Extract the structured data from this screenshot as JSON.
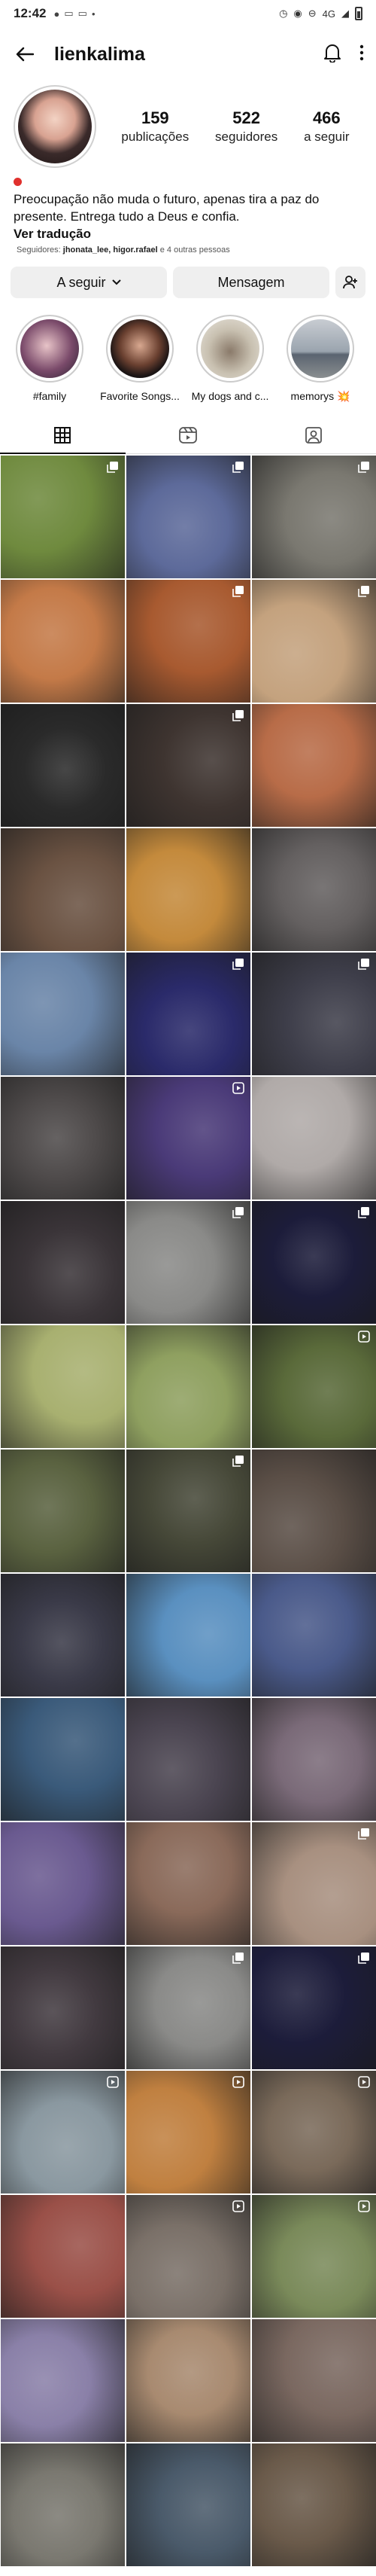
{
  "status": {
    "time": "12:42",
    "network": "4G"
  },
  "header": {
    "username": "lienkalima"
  },
  "profile": {
    "stats": [
      {
        "num": "159",
        "label": "publicações"
      },
      {
        "num": "522",
        "label": "seguidores"
      },
      {
        "num": "466",
        "label": "a seguir"
      }
    ],
    "bio_line1": "Preocupação não muda o futuro, apenas tira a paz do",
    "bio_line2": "presente. Entrega tudo a Deus e confia.",
    "translate": "Ver tradução",
    "followers_prefix": "Seguidores: ",
    "followers_names": "jhonata_lee, higor.rafael",
    "followers_suffix": " e 4 outras pessoas"
  },
  "actions": {
    "following": "A seguir",
    "message": "Mensagem"
  },
  "highlights": [
    {
      "label": "#family"
    },
    {
      "label": "Favorite Songs..."
    },
    {
      "label": "My dogs and c..."
    },
    {
      "label": "memorys 💥"
    }
  ],
  "grid": [
    {
      "c": "#6f8a3e",
      "badge": "multi"
    },
    {
      "c": "#5d6a9a",
      "badge": "multi"
    },
    {
      "c": "#7a7870",
      "badge": "multi"
    },
    {
      "c": "#c47a48",
      "badge": ""
    },
    {
      "c": "#a85a30",
      "badge": "multi"
    },
    {
      "c": "#c4a27e",
      "badge": "multi"
    },
    {
      "c": "#2a2a2a",
      "badge": ""
    },
    {
      "c": "#3e3430",
      "badge": "multi"
    },
    {
      "c": "#b86c48",
      "badge": ""
    },
    {
      "c": "#6a5242",
      "badge": ""
    },
    {
      "c": "#c48a3c",
      "badge": ""
    },
    {
      "c": "#646060",
      "badge": ""
    },
    {
      "c": "#6a85a8",
      "badge": ""
    },
    {
      "c": "#2a2a6a",
      "badge": "multi"
    },
    {
      "c": "#3e3e4a",
      "badge": "multi"
    },
    {
      "c": "#4e4a4a",
      "badge": ""
    },
    {
      "c": "#4a3a78",
      "badge": "reel"
    },
    {
      "c": "#b0aaa8",
      "badge": ""
    },
    {
      "c": "#3a3438",
      "badge": ""
    },
    {
      "c": "#8a8a88",
      "badge": "multi"
    },
    {
      "c": "#1c1c3a",
      "badge": "multi"
    },
    {
      "c": "#a8b070",
      "badge": ""
    },
    {
      "c": "#8fa060",
      "badge": ""
    },
    {
      "c": "#5a6a3a",
      "badge": "reel"
    },
    {
      "c": "#5a6240",
      "badge": ""
    },
    {
      "c": "#464838",
      "badge": "multi"
    },
    {
      "c": "#5a4e46",
      "badge": ""
    },
    {
      "c": "#3a3a48",
      "badge": ""
    },
    {
      "c": "#5a90c0",
      "badge": ""
    },
    {
      "c": "#4a5a8a",
      "badge": ""
    },
    {
      "c": "#3a5a7a",
      "badge": ""
    },
    {
      "c": "#4a4450",
      "badge": ""
    },
    {
      "c": "#7a6a78",
      "badge": ""
    },
    {
      "c": "#6a5a90",
      "badge": ""
    },
    {
      "c": "#8a6a5a",
      "badge": ""
    },
    {
      "c": "#a89080",
      "badge": "multi"
    },
    {
      "c": "#423a40",
      "badge": ""
    },
    {
      "c": "#8a8a88",
      "badge": "multi"
    },
    {
      "c": "#1c1c3a",
      "badge": "multi"
    },
    {
      "c": "#8a98a0",
      "badge": "reel"
    },
    {
      "c": "#c08040",
      "badge": "reel"
    },
    {
      "c": "#7a6a5a",
      "badge": "reel"
    },
    {
      "c": "#9a5048",
      "badge": ""
    },
    {
      "c": "#7a7068",
      "badge": "reel"
    },
    {
      "c": "#7a8a5a",
      "badge": "reel"
    },
    {
      "c": "#8a80a8",
      "badge": ""
    },
    {
      "c": "#a88a70",
      "badge": ""
    },
    {
      "c": "#7a6860",
      "badge": ""
    },
    {
      "c": "#7a7870",
      "badge": ""
    },
    {
      "c": "#4a5a6a",
      "badge": ""
    },
    {
      "c": "#6a5a4a",
      "badge": ""
    }
  ]
}
